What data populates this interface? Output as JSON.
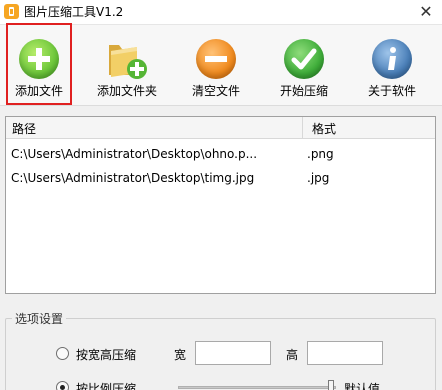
{
  "window": {
    "title": "图片压缩工具V1.2",
    "close_glyph": "✕"
  },
  "toolbar": {
    "add_file": "添加文件",
    "add_folder": "添加文件夹",
    "clear_file": "清空文件",
    "start_compress": "开始压缩",
    "about_software": "关于软件"
  },
  "file_list": {
    "columns": {
      "path": "路径",
      "format": "格式"
    },
    "rows": [
      {
        "path": "C:\\Users\\Administrator\\Desktop\\ohno.p...",
        "format": ".png"
      },
      {
        "path": "C:\\Users\\Administrator\\Desktop\\timg.jpg",
        "format": ".jpg"
      }
    ]
  },
  "options": {
    "group_title": "选项设置",
    "by_width_height": "按宽高压缩",
    "width_label": "宽",
    "height_label": "高",
    "width_value": "",
    "height_value": "",
    "by_ratio": "按比例压缩",
    "default_label": "默认值",
    "by_ratio_checked": true,
    "by_width_height_checked": false
  },
  "colors": {
    "add_green": "#6cc63a",
    "clear_orange": "#f08a1e",
    "start_green": "#3fae3a",
    "about_blue": "#4a7fb8",
    "highlight_red": "#e02020"
  }
}
